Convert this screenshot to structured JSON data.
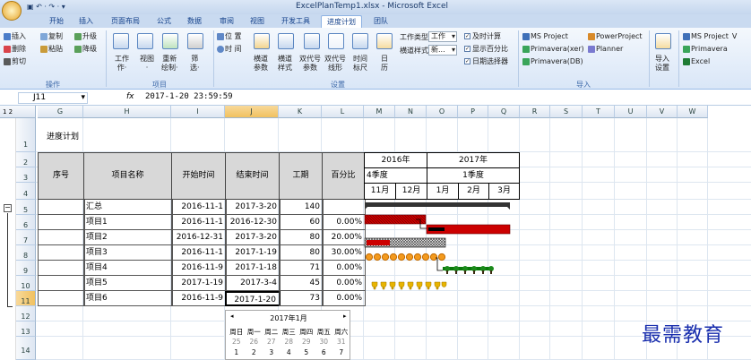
{
  "window_title": "ExcelPlanTemp1.xlsx - Microsoft Excel",
  "tabs": [
    "开始",
    "插入",
    "页面布局",
    "公式",
    "数据",
    "审阅",
    "视图",
    "开发工具",
    "进度计划",
    "团队"
  ],
  "active_tab": "进度计划",
  "ribbon": {
    "ops": {
      "insert": "插入",
      "delete": "删除",
      "cut": "剪切",
      "copy": "复制",
      "paste": "粘贴",
      "upgrade": "升级",
      "downgrade": "降级",
      "label": "操作"
    },
    "project": {
      "work": "工作",
      "work_arrow": "作·",
      "view": "视图",
      "view_arrow": "·",
      "update": "重新",
      "update2": "绘制·",
      "filter": "筛",
      "filter2": "选·",
      "label": "项目"
    },
    "settings": {
      "position": "位 置",
      "time": "时 间",
      "horiz": "横道",
      "horiz2": "参数",
      "horiz_style": "横道",
      "horiz_style2": "样式",
      "double": "双代号",
      "double2": "参数",
      "double_line": "双代号",
      "double_line2": "线形",
      "timeline": "时间",
      "timeline2": "标尺",
      "calendar": "日",
      "calendar2": "历",
      "work_type_label": "工作类型",
      "work_type_value": "工作",
      "horiz_type_label": "横道样式",
      "horiz_type_value": "新...",
      "label": "设置"
    },
    "checks": {
      "realtime": "及时计算",
      "show_pct": "显示百分比",
      "date_picker": "日期选择器"
    },
    "import": {
      "msproject": "MS Project",
      "powerproject": "PowerProject",
      "primavera_xer": "Primavera(xer)",
      "planner": "Planner",
      "primavera_db": "Primavera(DB)",
      "label": "导入"
    },
    "import_settings": {
      "l1": "导入",
      "l2": "设置"
    },
    "export": {
      "msproject": "MS Project",
      "primavera": "Primavera",
      "excel": "Excel",
      "l1": "V"
    }
  },
  "formula": {
    "name_box": "J11",
    "fx": "fx",
    "value": "2017-1-20  23:59:59"
  },
  "columns": [
    "G",
    "H",
    "I",
    "J",
    "K",
    "L",
    "M",
    "N",
    "O",
    "P",
    "Q",
    "R",
    "S",
    "T",
    "U",
    "V",
    "W"
  ],
  "rows": [
    "1",
    "2",
    "3",
    "4",
    "5",
    "6",
    "7",
    "8",
    "9",
    "10",
    "11",
    "12",
    "13",
    "14"
  ],
  "sheet": {
    "title": "进度计划",
    "headers": {
      "no": "序号",
      "name": "项目名称",
      "start": "开始时间",
      "end": "结束时间",
      "duration": "工期",
      "pct": "百分比"
    },
    "gantt_header": {
      "y2016": "2016年",
      "y2017": "2017年",
      "q4": "4季度",
      "q1": "1季度",
      "m11": "11月",
      "m12": "12月",
      "m1": "1月",
      "m2": "2月",
      "m3": "3月"
    },
    "rows": [
      {
        "name": "汇总",
        "start": "2016-11-1",
        "end": "2017-3-20",
        "duration": "140",
        "pct": ""
      },
      {
        "name": "项目1",
        "start": "2016-11-1",
        "end": "2016-12-30",
        "duration": "60",
        "pct": "0.00%"
      },
      {
        "name": "项目2",
        "start": "2016-12-31",
        "end": "2017-3-20",
        "duration": "80",
        "pct": "20.00%"
      },
      {
        "name": "项目3",
        "start": "2016-11-1",
        "end": "2017-1-19",
        "duration": "80",
        "pct": "30.00%"
      },
      {
        "name": "项目4",
        "start": "2016-11-9",
        "end": "2017-1-18",
        "duration": "71",
        "pct": "0.00%"
      },
      {
        "name": "项目5",
        "start": "2017-1-19",
        "end": "2017-3-4",
        "duration": "45",
        "pct": "0.00%"
      },
      {
        "name": "项目6",
        "start": "2016-11-9",
        "end": "2017-1-20",
        "duration": "73",
        "pct": "0.00%"
      }
    ]
  },
  "calendar": {
    "month": "2017年1月",
    "weekdays": [
      "周日",
      "周一",
      "周二",
      "周三",
      "周四",
      "周五",
      "周六"
    ],
    "week1": [
      "25",
      "26",
      "27",
      "28",
      "29",
      "30",
      "31"
    ],
    "week2": [
      "1",
      "2",
      "3",
      "4",
      "5",
      "6",
      "7"
    ]
  },
  "watermark": "最需教育",
  "colors": {
    "bar_red": "#cc0000",
    "summary": "#333333",
    "accent": "#15428b"
  }
}
